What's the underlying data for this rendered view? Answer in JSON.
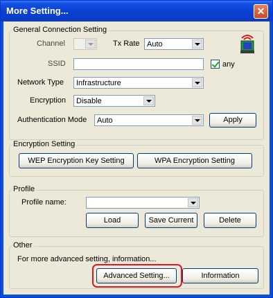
{
  "window": {
    "title": "More Setting...",
    "close_glyph": "✕"
  },
  "general": {
    "legend": "General Connection Setting",
    "channel_label": "Channel",
    "channel_value": "",
    "txrate_label": "Tx Rate",
    "txrate_value": "Auto",
    "ssid_label": "SSID",
    "ssid_value": "",
    "any_label": "any",
    "network_type_label": "Network Type",
    "network_type_value": "Infrastructure",
    "encryption_label": "Encryption",
    "encryption_value": "Disable",
    "auth_label": "Authentication Mode",
    "auth_value": "Auto",
    "apply_label": "Apply"
  },
  "encryption_setting": {
    "legend": "Encryption Setting",
    "wep_button": "WEP Encryption Key Setting",
    "wpa_button": "WPA Encryption Setting"
  },
  "profile": {
    "legend": "Profile",
    "name_label": "Profile name:",
    "name_value": "",
    "load_button": "Load",
    "save_button": "Save Current",
    "delete_button": "Delete"
  },
  "other": {
    "legend": "Other",
    "description": "For more advanced setting, information...",
    "advanced_button": "Advanced Setting...",
    "information_button": "Information"
  }
}
